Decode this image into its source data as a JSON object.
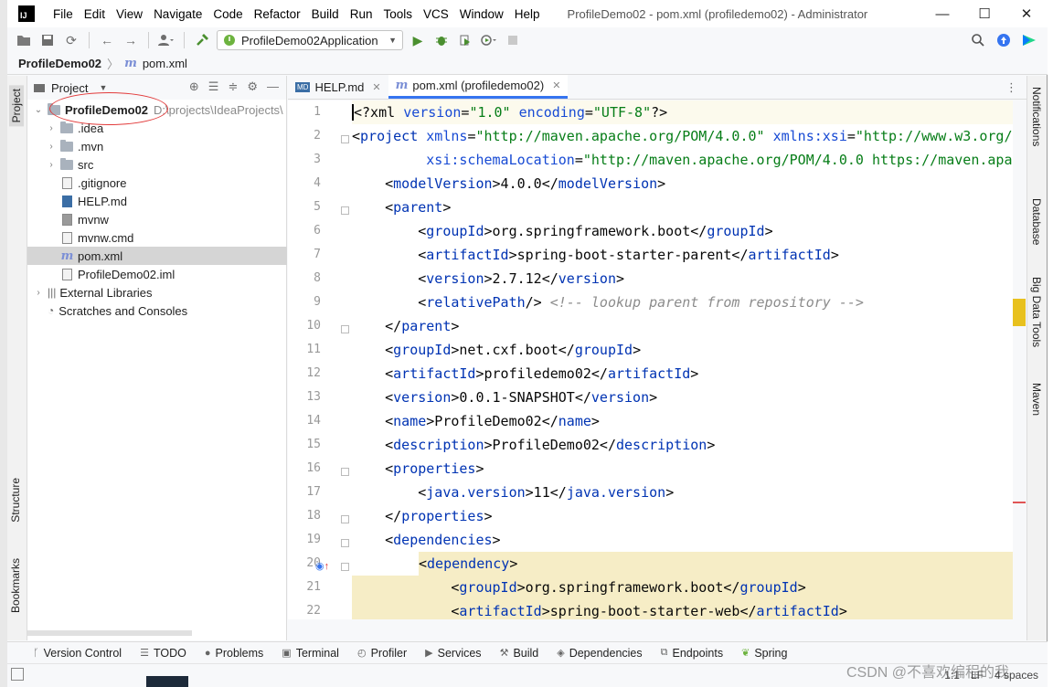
{
  "window": {
    "title": "ProfileDemo02 - pom.xml (profiledemo02) - Administrator",
    "logo": "IJ",
    "controls": {
      "minimize": "—",
      "maximize": "☐",
      "close": "✕"
    }
  },
  "menu": [
    "File",
    "Edit",
    "View",
    "Navigate",
    "Code",
    "Refactor",
    "Build",
    "Run",
    "Tools",
    "VCS",
    "Window",
    "Help"
  ],
  "toolbar": {
    "run_config": "ProfileDemo02Application"
  },
  "breadcrumb": {
    "project": "ProfileDemo02",
    "file": "pom.xml"
  },
  "left_tabs": {
    "project": "Project",
    "structure": "Structure",
    "bookmarks": "Bookmarks"
  },
  "project_panel": {
    "title": "Project",
    "root": {
      "name": "ProfileDemo02",
      "path": "D:\\projects\\IdeaProjects\\"
    },
    "items": [
      {
        "label": ".idea",
        "kind": "folder",
        "expandable": true
      },
      {
        "label": ".mvn",
        "kind": "folder",
        "expandable": true
      },
      {
        "label": "src",
        "kind": "folder",
        "expandable": true
      },
      {
        "label": ".gitignore",
        "kind": "file"
      },
      {
        "label": "HELP.md",
        "kind": "file"
      },
      {
        "label": "mvnw",
        "kind": "file"
      },
      {
        "label": "mvnw.cmd",
        "kind": "file"
      },
      {
        "label": "pom.xml",
        "kind": "maven",
        "selected": true
      },
      {
        "label": "ProfileDemo02.iml",
        "kind": "file"
      }
    ],
    "external": "External Libraries",
    "scratches": "Scratches and Consoles"
  },
  "editor": {
    "tabs": [
      {
        "label": "HELP.md",
        "active": false
      },
      {
        "label": "pom.xml (profiledemo02)",
        "active": true
      }
    ],
    "inspections": {
      "errors": "1",
      "warnings": "1"
    },
    "line_numbers": [
      "1",
      "2",
      "3",
      "4",
      "5",
      "6",
      "7",
      "8",
      "9",
      "10",
      "11",
      "12",
      "13",
      "14",
      "15",
      "16",
      "17",
      "18",
      "19",
      "20",
      "21",
      "22"
    ]
  },
  "right_tabs": {
    "notifications": "Notifications",
    "database": "Database",
    "bigdata": "Big Data Tools",
    "maven": "Maven"
  },
  "bottom_tools": [
    "Version Control",
    "TODO",
    "Problems",
    "Terminal",
    "Profiler",
    "Services",
    "Build",
    "Dependencies",
    "Endpoints",
    "Spring"
  ],
  "status": {
    "position": "1:1",
    "line_sep": "LF",
    "indent": "4 spaces"
  },
  "watermark": "CSDN @不喜欢编程的我",
  "colors": {
    "accent": "#3574f0",
    "tag": "#0033b3",
    "string": "#067d17",
    "comment": "#8c8c8c",
    "highlight": "#f6edc6"
  }
}
